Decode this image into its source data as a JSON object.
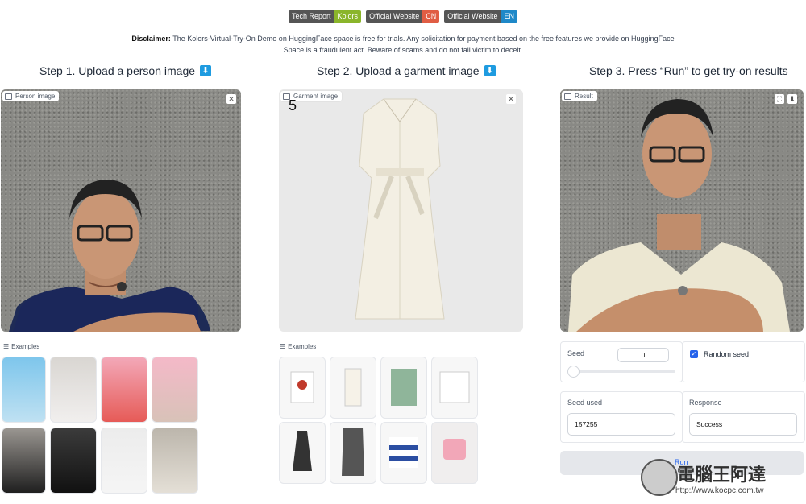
{
  "badges": [
    {
      "left": "Tech Report",
      "right": "Kolors",
      "color": "#8ab52a"
    },
    {
      "left": "Official Website",
      "right": "CN",
      "color": "#e05d44"
    },
    {
      "left": "Official Website",
      "right": "EN",
      "color": "#1e88c8"
    }
  ],
  "disclaimer": {
    "bold": "Disclaimer:",
    "text": " The Kolors-Virtual-Try-On Demo on HuggingFace space is free for trials. Any solicitation for payment based on the free features we provide on HuggingFace Space is a fraudulent act. Beware of scams and do not fall victim to deceit."
  },
  "steps": {
    "step1": "Step 1. Upload a person image",
    "step2": "Step 2. Upload a garment image",
    "step3": "Step 3. Press “Run” to get try-on results",
    "download_glyph": "⬇"
  },
  "panels": {
    "person_label": "Person image",
    "garment_label": "Garment image",
    "result_label": "Result",
    "garment_number": "5",
    "close_glyph": "✕"
  },
  "examples_label": "Examples",
  "controls": {
    "seed_label": "Seed",
    "seed_value": "0",
    "random_seed_label": "Random seed",
    "random_seed_checked": true,
    "seed_used_label": "Seed used",
    "seed_used_value": "157255",
    "response_label": "Response",
    "response_value": "Success",
    "run_label": "Run"
  },
  "watermark": {
    "title": "電腦王阿達",
    "url": "http://www.kocpc.com.tw"
  }
}
